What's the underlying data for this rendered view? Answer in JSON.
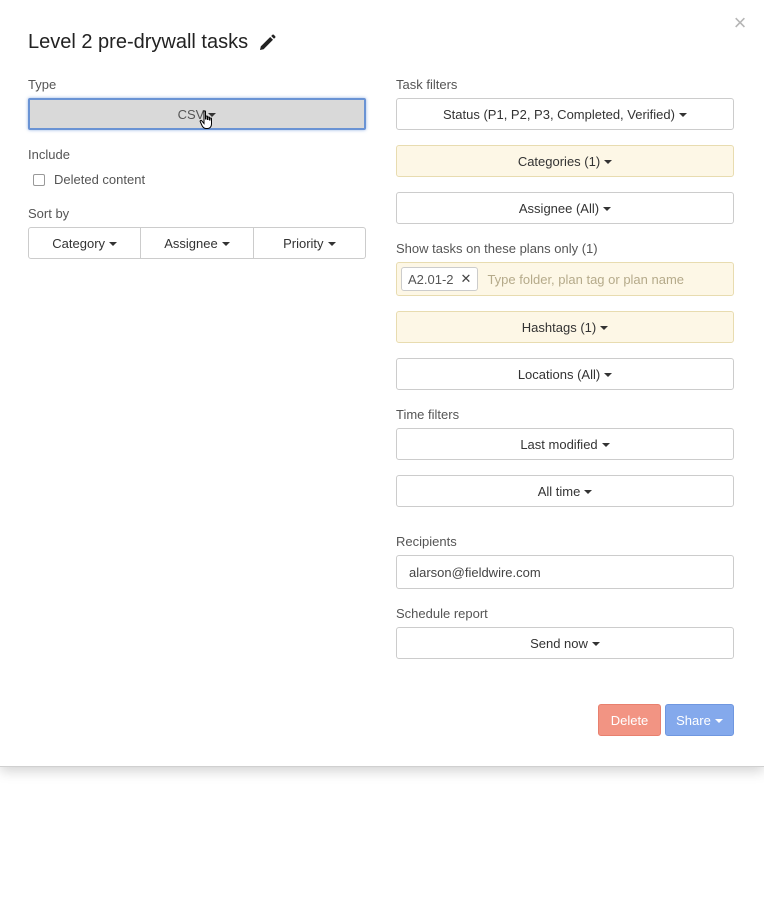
{
  "dialog": {
    "title": "Level 2 pre-drywall tasks",
    "close_symbol": "×"
  },
  "left": {
    "type_label": "Type",
    "type_value": "CSV",
    "include_label": "Include",
    "deleted_content_label": "Deleted content",
    "deleted_content_checked": false,
    "sort_by_label": "Sort by",
    "sort_options": [
      "Category",
      "Assignee",
      "Priority"
    ]
  },
  "right": {
    "task_filters_label": "Task filters",
    "status_filter": "Status (P1, P2, P3, Completed, Verified)",
    "categories_filter": "Categories (1)",
    "assignee_filter": "Assignee (All)",
    "plans_label": "Show tasks on these plans only (1)",
    "plan_chip": "A2.01-2",
    "plans_placeholder": "Type folder, plan tag or plan name",
    "hashtags_filter": "Hashtags (1)",
    "locations_filter": "Locations (All)",
    "time_filters_label": "Time filters",
    "time_field": "Last modified",
    "time_range": "All time",
    "recipients_label": "Recipients",
    "recipients_value": "alarson@fieldwire.com",
    "schedule_label": "Schedule report",
    "schedule_value": "Send now"
  },
  "footer": {
    "delete_label": "Delete",
    "share_label": "Share"
  },
  "colors": {
    "filter_active_bg": "#fdf7e6",
    "delete_bg": "#f29483",
    "share_bg": "#84a9ec",
    "focus_ring": "#6a93d4"
  }
}
